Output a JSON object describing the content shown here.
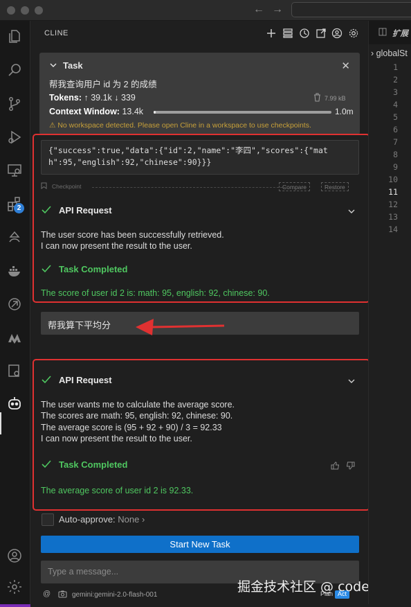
{
  "panel": {
    "title": "CLINE"
  },
  "task": {
    "label": "Task",
    "text": "帮我查询用户 id 为 2 的成绩",
    "tokens_label": "Tokens:",
    "tokens_value": "↑ 39.1k ↓ 339",
    "size": "7.99 kB",
    "context_label": "Context Window:",
    "context_used": "13.4k",
    "context_max": "1.0m",
    "context_fraction": 0.0134,
    "warning": "No workspace detected. Please open Cline in a workspace to use checkpoints."
  },
  "first_response": {
    "json_line1": "{\"success\":true,\"data\":{\"id\":2,\"name\":\"李四\",\"scores\":{\"mat",
    "json_line2": "h\":95,\"english\":92,\"chinese\":90}}}",
    "checkpoint_label": "Checkpoint",
    "compare_label": "Compare",
    "restore_label": "Restore",
    "api_label": "API Request",
    "body_line1": "The user score has been successfully retrieved.",
    "body_line2": "I can now present the result to the user.",
    "completed_label": "Task Completed",
    "result": "The score of user id 2 is: math: 95, english: 92, chinese: 90."
  },
  "user_message": "帮我算下平均分",
  "second_response": {
    "api_label": "API Request",
    "body_line1": "The user wants me to calculate the average score.",
    "body_line2": "The scores are math: 95, english: 92, chinese: 90.",
    "body_line3": "The average score is (95 + 92 + 90) / 3 = 92.33",
    "body_line4": "I can now present the result to the user.",
    "completed_label": "Task Completed",
    "result": "The average score of user id 2 is 92.33."
  },
  "auto_approve": {
    "label": "Auto-approve:",
    "value": "None"
  },
  "start_button": "Start New Task",
  "input_placeholder": "Type a message...",
  "model": "gemini:gemini-2.0-flash-001",
  "mode": {
    "plan": "Plan",
    "act": "Act"
  },
  "watermark": "掘金技术社区 @ codelang",
  "editor": {
    "tab": "扩展",
    "breadcrumb": "globalSt",
    "line_numbers": [
      "1",
      "2",
      "3",
      "4",
      "5",
      "6",
      "7",
      "8",
      "9",
      "10",
      "11",
      "12",
      "13",
      "14"
    ],
    "current_line": "11"
  },
  "activity_badge": "2",
  "colors": {
    "accent_blue": "#0f70c9",
    "success_green": "#4fc760",
    "warning_yellow": "#c7a03a",
    "annotation_red": "#e03131"
  }
}
